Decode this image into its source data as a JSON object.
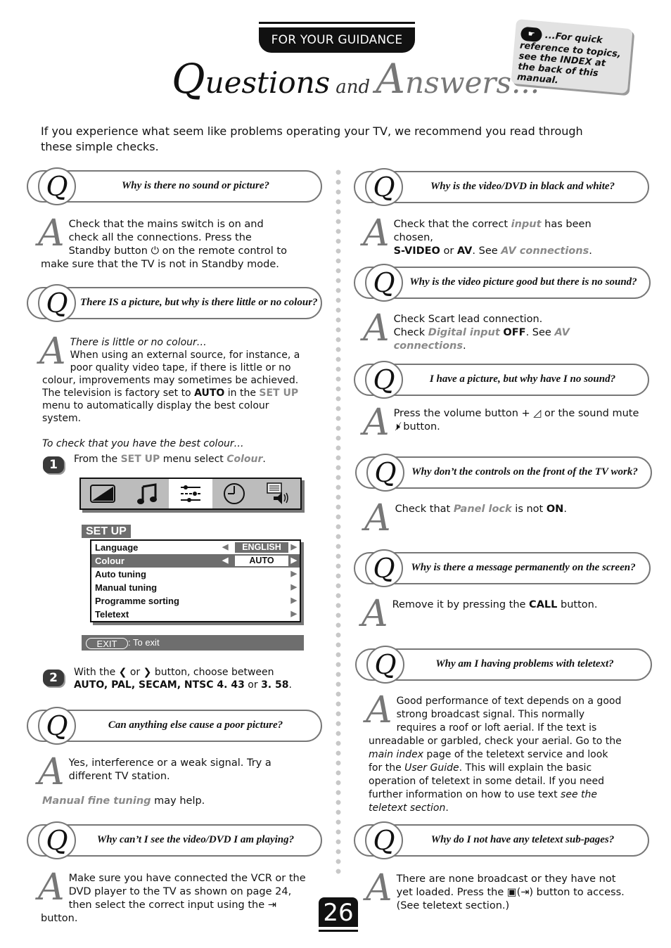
{
  "header": {
    "section_label": "FOR YOUR GUIDANCE",
    "title": {
      "q_cap": "Q",
      "q_rest": "uestions",
      "and": "and",
      "a_cap": "A",
      "a_rest": "nswers..."
    },
    "note": {
      "icon": "pointing-hand-icon",
      "text": "...For quick reference to topics, see the INDEX at the back of this manual."
    }
  },
  "intro": "If you experience what seem like problems operating your TV, we recommend you read through these simple checks.",
  "left_column": [
    {
      "question": "Why is there no sound or picture?",
      "answer_parts": [
        "Check that the mains switch is on and check all the connections. Press the Standby button ",
        " on the remote control to make sure that the TV is not in Standby mode."
      ],
      "icon": "power-standby-icon"
    },
    {
      "question": "There IS a picture, but why is there little or no colour?",
      "answer": {
        "lead_italic": "There is little or no colour…",
        "text1": "When using an external source, for instance, a poor quality video tape, if there is little or no colour, improvements may sometimes be achieved. The television is factory set to ",
        "bold1": "AUTO",
        "text2": " in the ",
        "hl1": "SET UP",
        "text3": " menu to automatically display the best colour system.",
        "check_italic": "To check that you have the best colour…"
      },
      "steps": [
        {
          "number": "1",
          "text1": "From the ",
          "hl1": "SET UP",
          "text2": " menu select ",
          "hl2": "Colour",
          "text3": "."
        },
        {
          "number": "2",
          "text1": "With the ",
          "icon_left": "chevron-left",
          "text2": " or ",
          "icon_right": "chevron-right",
          "text3": " button, choose between ",
          "bold1": "AUTO, PAL, SECAM, NTSC 4. 43",
          "text4": " or ",
          "bold2": "3. 58",
          "text5": "."
        }
      ],
      "menu_screen": {
        "icons": [
          "picture-icon",
          "music-note-icon",
          "setup-sliders-icon",
          "clock-icon",
          "teletext-sound-icon"
        ],
        "active_icon_index": 2,
        "label": "SET UP",
        "rows": [
          {
            "label": "Language",
            "value": "ENGLISH",
            "selected": false
          },
          {
            "label": "Colour",
            "value": "AUTO",
            "selected": true
          },
          {
            "label": "Auto  tuning"
          },
          {
            "label": "Manual  tuning"
          },
          {
            "label": "Programme  sorting"
          },
          {
            "label": "Teletext"
          }
        ],
        "exit_button": "EXIT",
        "exit_text": ": To exit"
      }
    },
    {
      "question": "Can anything else cause a poor picture?",
      "answer": "Yes, interference or a weak signal. Try a different TV station.",
      "extra_hl": "Manual fine tuning",
      "extra_text": " may help."
    },
    {
      "question": "Why can’t I see the video/DVD I am playing?",
      "answer_parts": [
        "Make sure you have connected the VCR or the DVD player to the TV as shown on page 24, then select the correct input using the ",
        " button."
      ],
      "icon": "input-select-icon"
    }
  ],
  "right_column": [
    {
      "question": "Why is the video/DVD in black and white?",
      "answer": {
        "t1": "Check that the correct ",
        "hl1": "input",
        "t2": " has been chosen, ",
        "b1": "S-VIDEO",
        "t3": " or ",
        "b2": "AV",
        "t4": ". See ",
        "hl2": "AV connections",
        "t5": "."
      }
    },
    {
      "question": "Why is the video picture good but there is no sound?",
      "answer": {
        "line1": "Check Scart lead connection.",
        "t1": "Check ",
        "hl1": "Digital input",
        "t2": " ",
        "b1": "OFF",
        "t3": ". See ",
        "hl2": "AV connections",
        "t4": "."
      }
    },
    {
      "question": "I have a picture, but why have I no sound?",
      "answer": {
        "t1": "Press the volume button ",
        "sym1": "+",
        "t2": " or the sound mute ",
        "t3": " button."
      },
      "icons": [
        "volume-up-icon",
        "mute-icon"
      ]
    },
    {
      "question": "Why don’t the controls on the front of the TV work?",
      "answer": {
        "t1": "Check that ",
        "hl1": "Panel lock",
        "t2": " is not ",
        "b1": "ON",
        "t3": "."
      }
    },
    {
      "question": "Why is there a message permanently on the screen?",
      "answer": {
        "t1": "Remove it by pressing the ",
        "b1": "CALL",
        "t2": " button."
      }
    },
    {
      "question": "Why am I having problems with teletext?",
      "answer": {
        "t1": "Good performance of text depends on a good strong broadcast signal. This normally requires a roof or loft aerial. If the text is unreadable or garbled, check your aerial. Go to the ",
        "i1": "main index",
        "t2": " page of the teletext service and look for the ",
        "i2": "User Guide",
        "t3": ". This will explain the basic operation of teletext in some detail. If you need further information on how to use text ",
        "i3": "see the teletext section",
        "t4": "."
      }
    },
    {
      "question": "Why do I not have any teletext sub-pages?",
      "answer": {
        "t1": "There are none broadcast or they have not yet loaded. Press the ",
        "t2": "(",
        "t3": ") button to access.",
        "t4": "(See teletext section.)"
      },
      "icons": [
        "teletext-button-icon",
        "input-select-icon"
      ]
    }
  ],
  "page_number": "26"
}
